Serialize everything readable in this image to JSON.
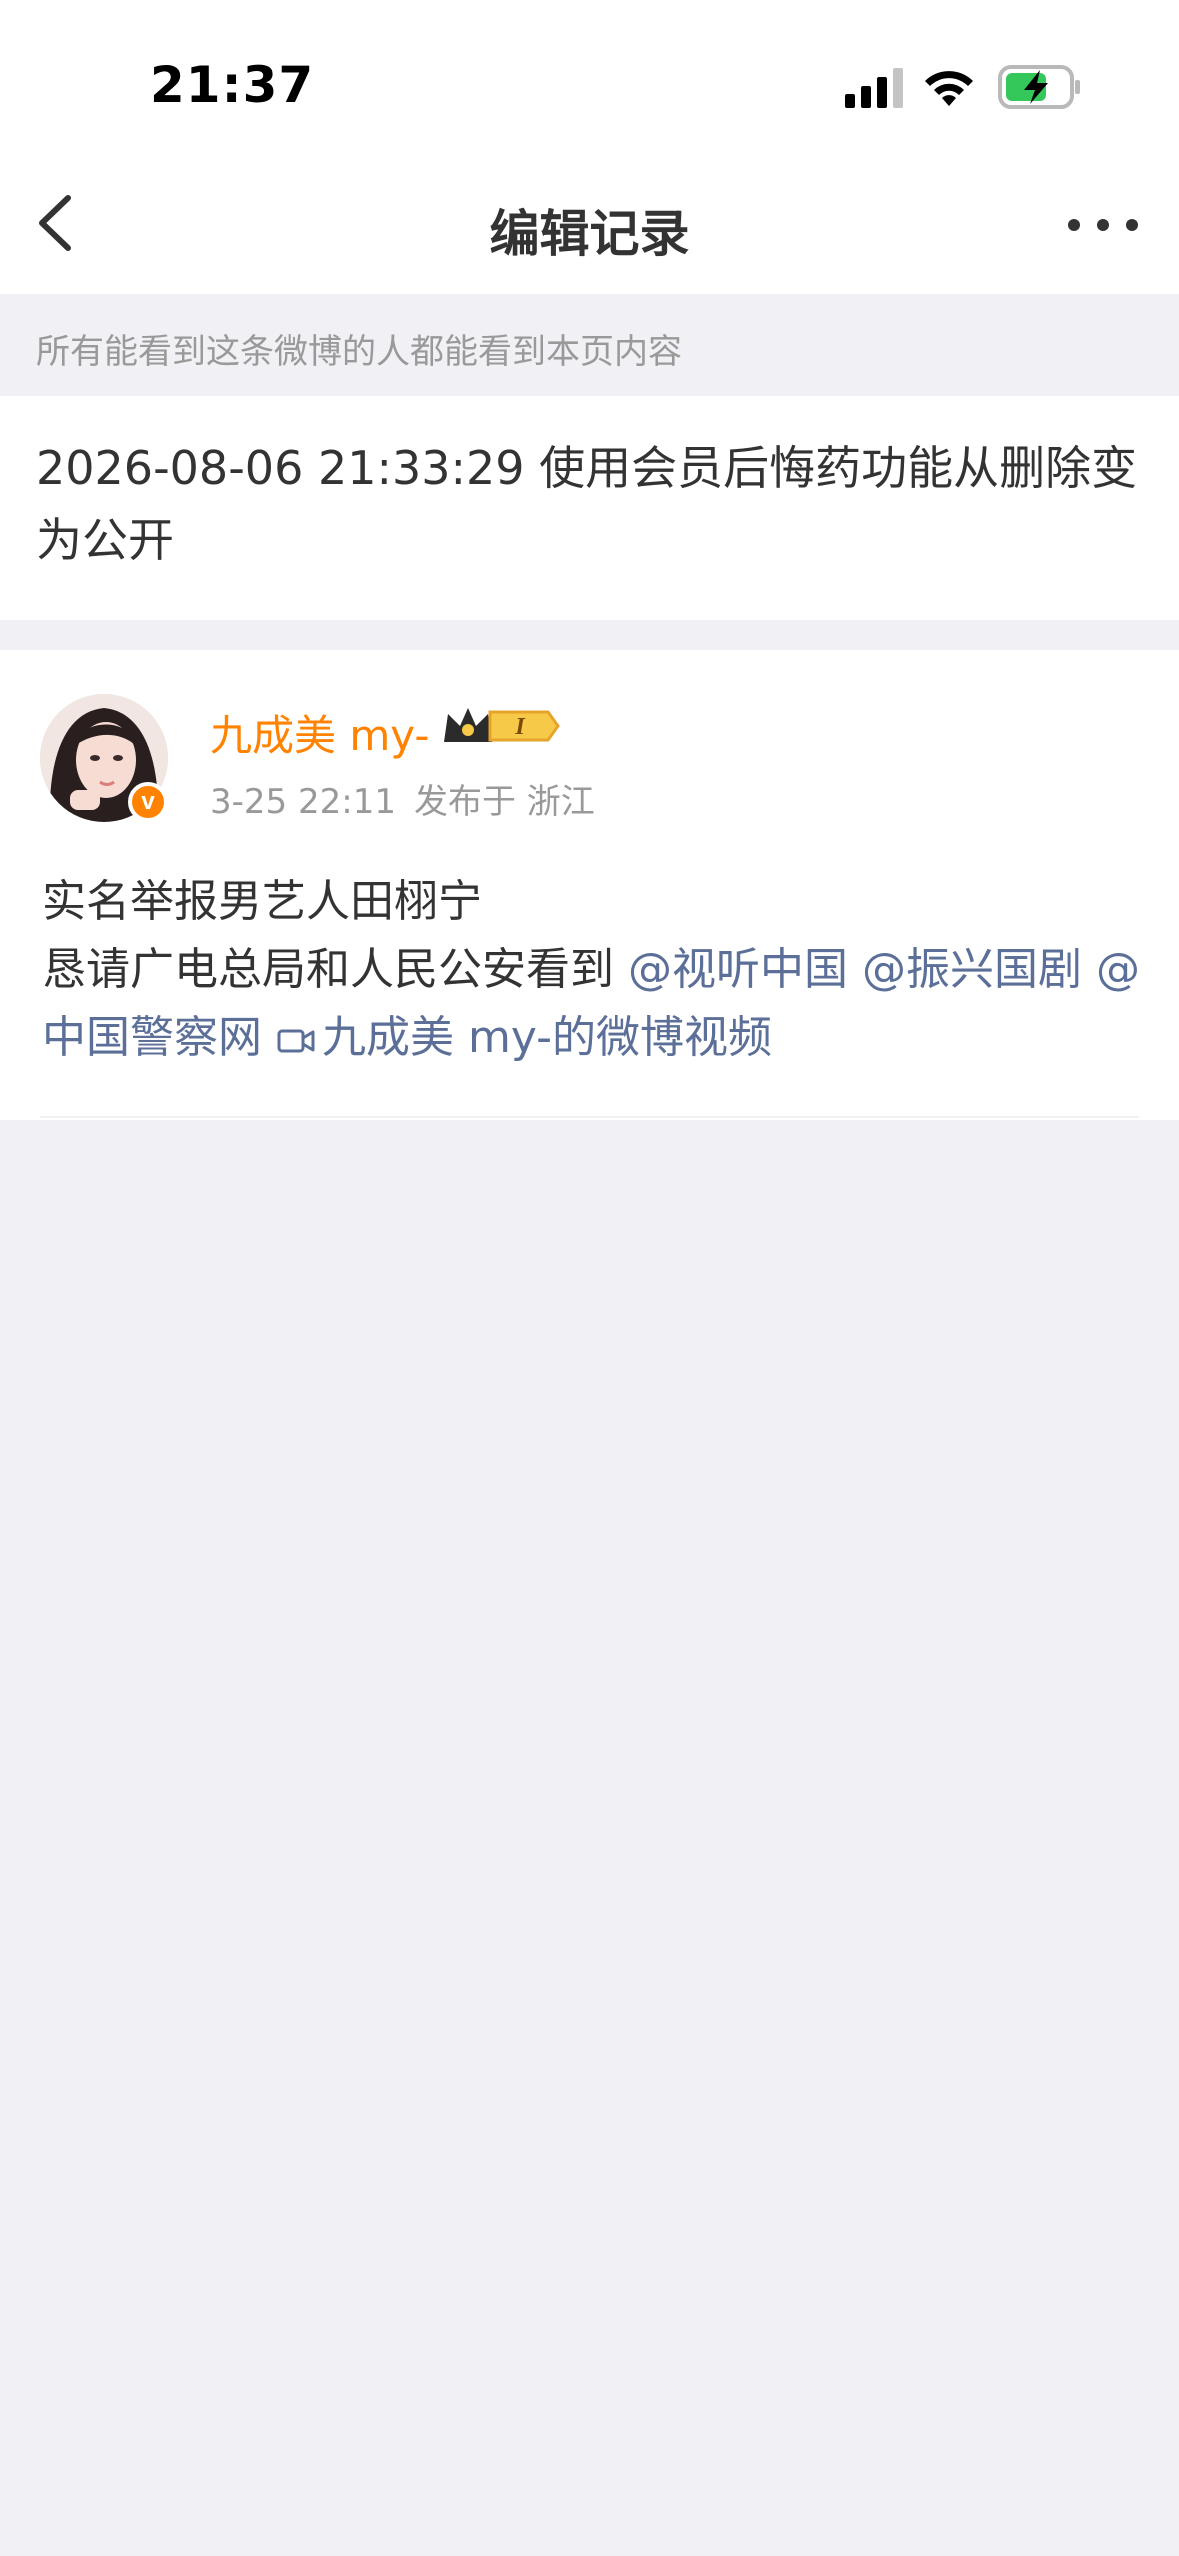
{
  "status_bar": {
    "time": "21:37",
    "icons": [
      "signal-icon",
      "wifi-icon",
      "battery-charging-icon"
    ]
  },
  "nav": {
    "title": "编辑记录",
    "back_icon": "chevron-left-icon",
    "more_icon": "more-dots-icon"
  },
  "notice": {
    "text": "所有能看到这条微博的人都能看到本页内容"
  },
  "edit_record": {
    "text": "2026-08-06 21:33:29 使用会员后悔药功能从删除变为公开"
  },
  "post": {
    "author": {
      "name": "九成美 my-",
      "verified_label": "v",
      "vip_level": "I"
    },
    "time": "3-25 22:11",
    "location": "发布于 浙江",
    "content": {
      "line1": "实名举报男艺人田栩宁",
      "line2_text": "恳请广电总局和人民公安看到 ",
      "mentions": [
        "@视听中国",
        "@振兴国剧",
        "@中国警察网"
      ],
      "video_link": "九成美 my-的微博视频"
    }
  },
  "colors": {
    "accent_orange": "#ff8200",
    "link_blue": "#5b6f99",
    "page_bg": "#f0f0f5",
    "muted_text": "#999999"
  }
}
